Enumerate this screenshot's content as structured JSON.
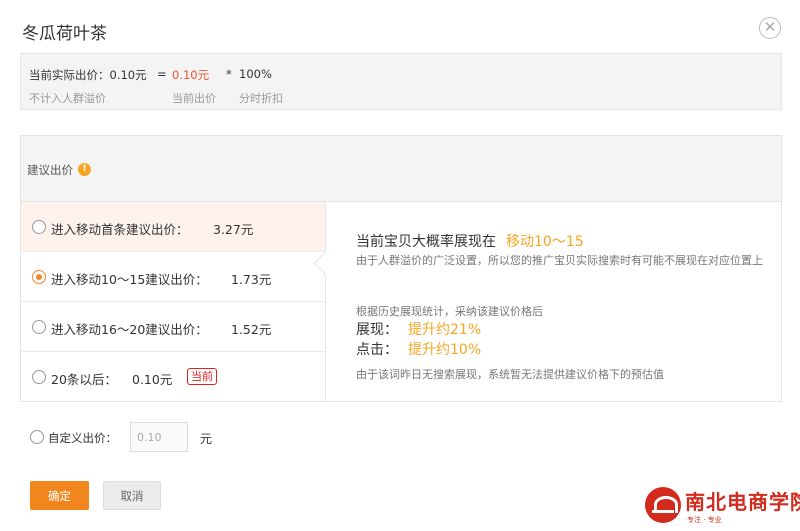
{
  "dialog": {
    "title": "冬瓜荷叶茶",
    "close_icon": "close-icon"
  },
  "summary": {
    "actual_bid_label": "当前实际出价：0.10元",
    "eq": "=",
    "current_bid_value": "0.10元",
    "times": "*",
    "discount_value": "100%",
    "note_crowd": "不计入人群溢价",
    "note_current": "当前出价",
    "note_discount": "分时折扣"
  },
  "suggest": {
    "header_label": "建议出价",
    "info_icon": "info-icon",
    "options": [
      {
        "label": "进入移动首条建议出价：",
        "value": "3.27元",
        "checked": false
      },
      {
        "label": "进入移动10～15建议出价：",
        "value": "1.73元",
        "checked": true
      },
      {
        "label": "进入移动16～20建议出价：",
        "value": "1.52元",
        "checked": false
      },
      {
        "label": "20条以后：",
        "value": "0.10元",
        "checked": false,
        "badge": "当前"
      }
    ],
    "detail": {
      "headline": "当前宝贝大概率展现在",
      "headline_value": "移动10～15",
      "note": "由于人群溢价的广泛设置，所以您的推广宝贝实际搜索时有可能不展现在对应位置上",
      "basis": "根据历史展现统计，采纳该建议价格后",
      "impressions_label": "展现：",
      "impressions_value": "提升约21%",
      "clicks_label": "点击：",
      "clicks_value": "提升约10%",
      "foot": "由于该词昨日无搜索展现，系统暂无法提供建议价格下的预估值"
    }
  },
  "custom": {
    "label": "自定义出价：",
    "input_value": "0.10",
    "unit": "元"
  },
  "buttons": {
    "confirm": "确定",
    "cancel": "取消"
  },
  "watermark": {
    "text": "南北电商学院",
    "sub": "专注 · 专业"
  },
  "colors": {
    "accent": "#f2861e",
    "highlight": "#f6a623",
    "price_red": "#f2522e"
  }
}
